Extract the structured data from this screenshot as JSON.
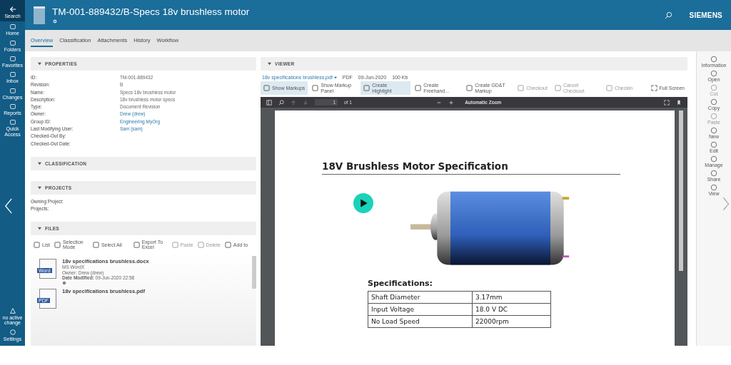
{
  "header": {
    "title": "TM-001-889432/B-Specs 18v brushless motor",
    "brand": "SIEMENS"
  },
  "nav": {
    "items": [
      {
        "label": "Search",
        "selected": true
      },
      {
        "label": "Home",
        "selected": false
      },
      {
        "label": "Folders",
        "selected": false
      },
      {
        "label": "Favorites",
        "selected": false
      },
      {
        "label": "Inbox",
        "selected": false
      },
      {
        "label": "Changes",
        "selected": false
      },
      {
        "label": "Reports",
        "selected": false
      },
      {
        "label": "Quick Access",
        "selected": false
      }
    ],
    "change": "no active change",
    "settings": "Settings"
  },
  "tabs": [
    {
      "label": "Overview",
      "selected": true
    },
    {
      "label": "Classification",
      "selected": false
    },
    {
      "label": "Attachments",
      "selected": false
    },
    {
      "label": "History",
      "selected": false
    },
    {
      "label": "Workflow",
      "selected": false
    }
  ],
  "properties": {
    "title": "PROPERTIES",
    "expanded": true,
    "rows": [
      {
        "label": "ID:",
        "value": "TM-001-889432",
        "kind": "text"
      },
      {
        "label": "Revision:",
        "value": "B",
        "kind": "text"
      },
      {
        "label": "Name:",
        "value": "Specs 18v brushless motor",
        "kind": "text"
      },
      {
        "label": "Description:",
        "value": "18v brushless motor specs",
        "kind": "text"
      },
      {
        "label": "Type:",
        "value": "Document Revision",
        "kind": "text"
      },
      {
        "label": "Owner:",
        "value": "Drew (drew)",
        "kind": "link"
      },
      {
        "label": "Group ID:",
        "value": "Engineering.MyOrg",
        "kind": "link"
      },
      {
        "label": "Last Modifying User:",
        "value": "Sam (sam)",
        "kind": "link"
      },
      {
        "label": "Checked-Out By:"
      },
      {
        "label": "Checked-Out Date:"
      }
    ]
  },
  "classification": {
    "title": "CLASSIFICATION",
    "expanded": true
  },
  "projects": {
    "title": "PROJECTS",
    "expanded": true,
    "rows": [
      {
        "label": "Owning Project:"
      },
      {
        "label": "Projects:"
      }
    ]
  },
  "files": {
    "title": "FILES",
    "expanded": true,
    "toolbar": [
      {
        "label": "List",
        "disabled": false
      },
      {
        "label": "Selection Mode",
        "disabled": false
      },
      {
        "label": "Select All",
        "disabled": false
      },
      {
        "label": "Export To Excel",
        "disabled": false
      },
      {
        "label": "Paste",
        "disabled": true
      },
      {
        "label": "Delete",
        "disabled": true
      },
      {
        "label": "Add to",
        "disabled": false
      }
    ],
    "items": [
      {
        "name": "18v specifications brushless.docx",
        "badge": "Word",
        "type": "MS WordX",
        "owner_label": "Owner:",
        "owner": "Drew (drew)",
        "date_label": "Date Modified:",
        "date": "09-Jun-2020 22:58"
      },
      {
        "name": "18v specifications brushless.pdf",
        "badge": "PDF"
      }
    ]
  },
  "viewer": {
    "title": "VIEWER",
    "expanded": true,
    "file": "18v specifications brushless.pdf",
    "meta": [
      "PDF",
      "09-Jun-2020",
      "100 Kb"
    ],
    "commands": [
      {
        "label": "Show Markups",
        "selected": true,
        "disabled": false
      },
      {
        "label": "Show Markup Panel",
        "selected": false,
        "disabled": false
      },
      {
        "label": "Create Highlight",
        "selected": true,
        "disabled": false
      },
      {
        "label": "Create Freehand...",
        "selected": false,
        "disabled": false
      },
      {
        "label": "Create GD&T Markup",
        "selected": false,
        "disabled": false
      },
      {
        "label": "Checkout",
        "selected": false,
        "disabled": true
      },
      {
        "label": "Cancel Checkout",
        "selected": false,
        "disabled": true
      },
      {
        "label": "Checkin",
        "selected": false,
        "disabled": true
      }
    ],
    "full_screen": "Full Screen",
    "pdf_toolbar": {
      "page": "1",
      "of": "of 1",
      "zoom": "Automatic Zoom"
    },
    "document": {
      "heading": "18V Brushless Motor Specification",
      "spec_heading": "Specifications:",
      "specs": [
        {
          "name": "Shaft Diameter",
          "value": "3.17mm"
        },
        {
          "name": "Input Voltage",
          "value": "18.0 V DC"
        },
        {
          "name": "No Load Speed",
          "value": "22000rpm"
        }
      ]
    }
  },
  "commands": [
    {
      "label": "Information",
      "disabled": false
    },
    {
      "label": "Open",
      "disabled": false
    },
    {
      "label": "Cut",
      "disabled": true
    },
    {
      "label": "Copy",
      "disabled": false
    },
    {
      "label": "Paste",
      "disabled": true
    },
    {
      "label": "New",
      "disabled": false
    },
    {
      "label": "Edit",
      "disabled": false
    },
    {
      "label": "Manage",
      "disabled": false
    },
    {
      "label": "Share",
      "disabled": false
    },
    {
      "label": "View",
      "disabled": false
    }
  ]
}
